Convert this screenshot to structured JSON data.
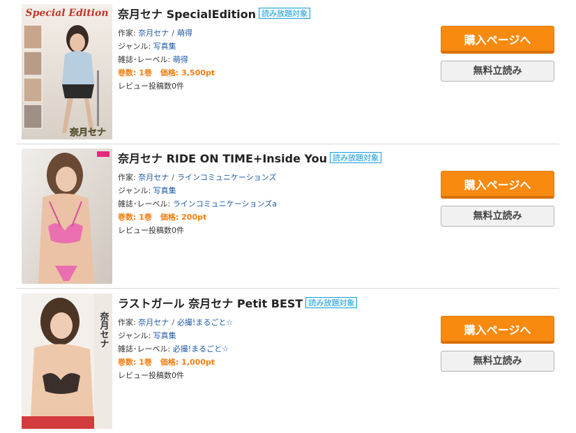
{
  "items": [
    {
      "title": "奈月セナ SpecialEdition",
      "badge": "読み放題対象",
      "author_label": "作家:",
      "authors": [
        "奈月セナ",
        "萌得"
      ],
      "genre_label": "ジャンル:",
      "genre": "写真集",
      "label_label": "雑誌･レーベル:",
      "label": "萌得",
      "volumes_label": "巻数:",
      "volumes": "1巻",
      "price_label": "価格:",
      "price": "3,500pt",
      "review_text": "レビュー投稿数0件",
      "buy_label": "購入ページへ",
      "free_read_label": "無料立読み",
      "cover_text": [
        "Special Edition",
        "奈月セナ"
      ]
    },
    {
      "title": "奈月セナ RIDE ON TIME+Inside You",
      "badge": "読み放題対象",
      "author_label": "作家:",
      "authors": [
        "奈月セナ",
        "ラインコミュニケーションズ"
      ],
      "genre_label": "ジャンル:",
      "genre": "写真集",
      "label_label": "雑誌･レーベル:",
      "label": "ラインコミュニケーションズa",
      "volumes_label": "巻数:",
      "volumes": "1巻",
      "price_label": "価格:",
      "price": "200pt",
      "review_text": "レビュー投稿数0件",
      "buy_label": "購入ページへ",
      "free_read_label": "無料立読み"
    },
    {
      "title": "ラストガール 奈月セナ Petit BEST",
      "badge": "読み放題対象",
      "author_label": "作家:",
      "authors": [
        "奈月セナ",
        "必撮!まるごと☆"
      ],
      "genre_label": "ジャンル:",
      "genre": "写真集",
      "label_label": "雑誌･レーベル:",
      "label": "必撮!まるごと☆",
      "volumes_label": "巻数:",
      "volumes": "1巻",
      "price_label": "価格:",
      "price": "1,000pt",
      "review_text": "レビュー投稿数0件",
      "buy_label": "購入ページへ",
      "free_read_label": "無料立読み",
      "cover_text": [
        "奈月セナ"
      ]
    }
  ],
  "colors": {
    "accent": "#f78a0f",
    "link": "#1c5aa6",
    "badge": "#1b9fd7",
    "price": "#f57d10"
  }
}
